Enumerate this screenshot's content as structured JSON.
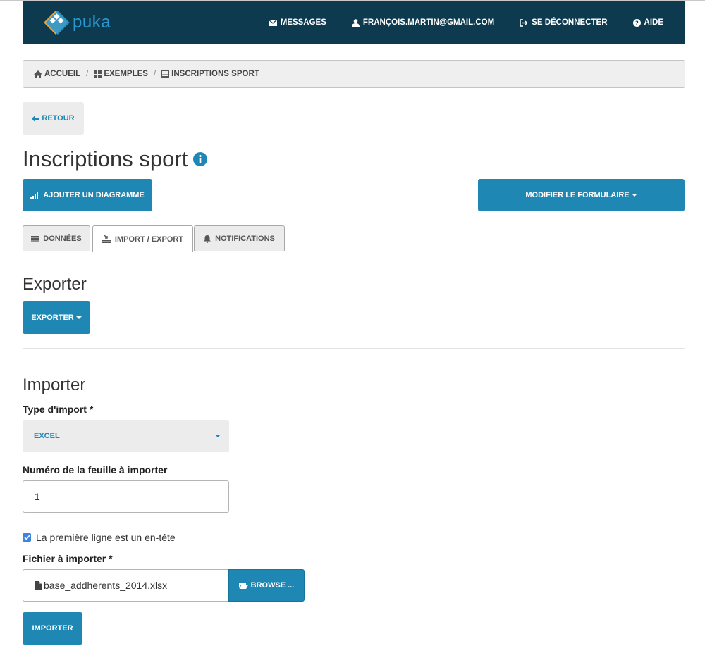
{
  "app": {
    "logo_text": "puka"
  },
  "nav": {
    "messages": "MESSAGES",
    "user": "FRANÇOIS.MARTIN@GMAIL.COM",
    "logout": "SE DÉCONNECTER",
    "help": "AIDE"
  },
  "breadcrumb": {
    "home": "ACCUEIL",
    "examples": "EXEMPLES",
    "current": "INSCRIPTIONS SPORT",
    "separator": "/"
  },
  "back_label": "RETOUR",
  "page_title": "Inscriptions sport",
  "actions": {
    "add_chart": "AJOUTER UN DIAGRAMME",
    "modify_form": "MODIFIER LE FORMULAIRE"
  },
  "tabs": [
    {
      "label": "DONNÉES"
    },
    {
      "label": "IMPORT / EXPORT"
    },
    {
      "label": "NOTIFICATIONS"
    }
  ],
  "export_section": {
    "title": "Exporter",
    "button": "EXPORTER"
  },
  "import_section": {
    "title": "Importer",
    "type_label": "Type d'import *",
    "type_value": "EXCEL",
    "sheet_label": "Numéro de la feuille à importer",
    "sheet_value": "1",
    "header_checkbox_label": "La première ligne est un en-tête",
    "header_checked": true,
    "file_label": "Fichier à importer *",
    "file_name": "base_addherents_2014.xlsx",
    "browse_button": "BROWSE ...",
    "import_button": "IMPORTER"
  },
  "colors": {
    "navbar": "#0d3a4e",
    "primary": "#1f87b3",
    "logo": "#2a9ad3"
  },
  "icons": [
    "logo-icon",
    "envelope-icon",
    "user-icon",
    "logout-icon",
    "help-icon",
    "home-icon",
    "grid-icon",
    "table-icon",
    "arrow-left-icon",
    "info-icon",
    "bar-chart-icon",
    "list-icon",
    "import-export-icon",
    "bell-icon",
    "check-icon",
    "file-icon",
    "folder-open-icon"
  ]
}
